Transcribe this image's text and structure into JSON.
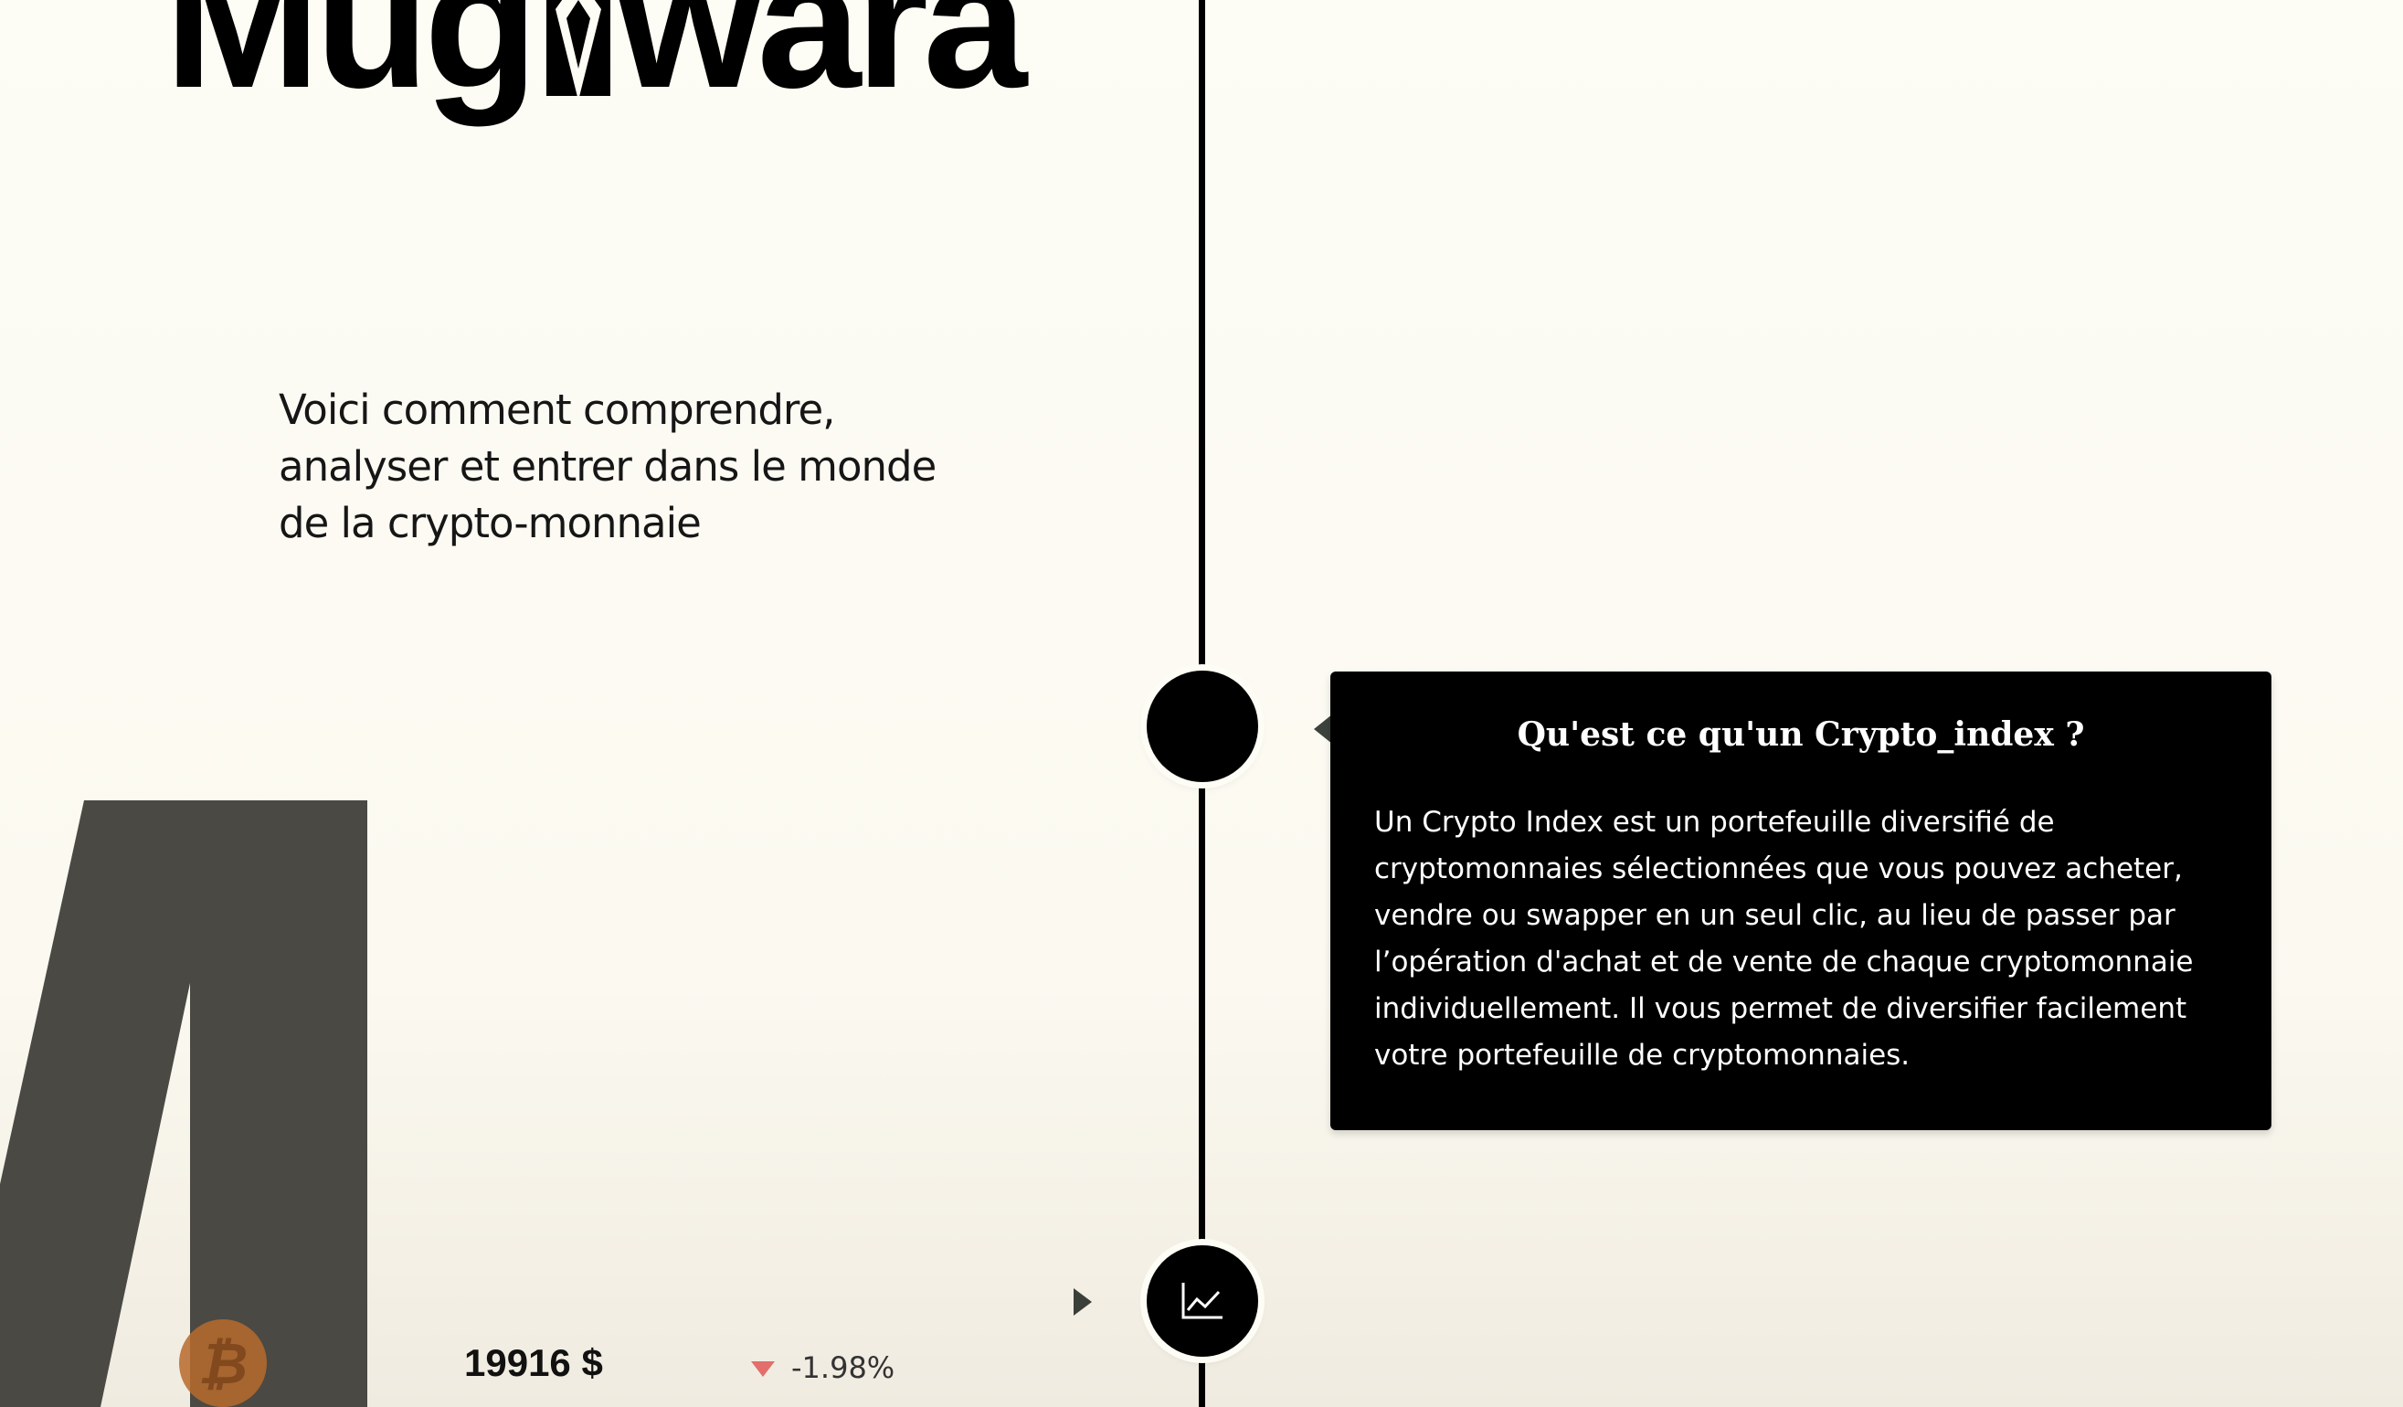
{
  "brand": {
    "logo_text": "Mugiwara"
  },
  "intro": {
    "text": "Voici comment comprendre, analyser et entrer dans le monde de la crypto-monnaie"
  },
  "card": {
    "title": "Qu'est ce qu'un Crypto_index ?",
    "body": "Un Crypto Index est un portefeuille diversifié de cryptomonnaies sélectionnées que vous pouvez acheter, vendre ou swapper en un seul clic, au lieu de passer par l’opération d'achat et de vente de chaque cryptomonnaie individuellement. Il vous permet de diversifier facilement votre portefeuille de cryptomonnaies."
  },
  "ticker": {
    "coin_icon": "bitcoin-icon",
    "coin_symbol": "₿",
    "price": "19916 $",
    "change": "-1.98%",
    "change_color": "#e26f6b"
  },
  "timeline": {
    "step2_icon": "line-chart-icon"
  },
  "colors": {
    "background": "#fdfcf5",
    "accent_dark": "#000000",
    "decor_grey": "#4a4944",
    "btc_orange": "#b86a2c"
  }
}
